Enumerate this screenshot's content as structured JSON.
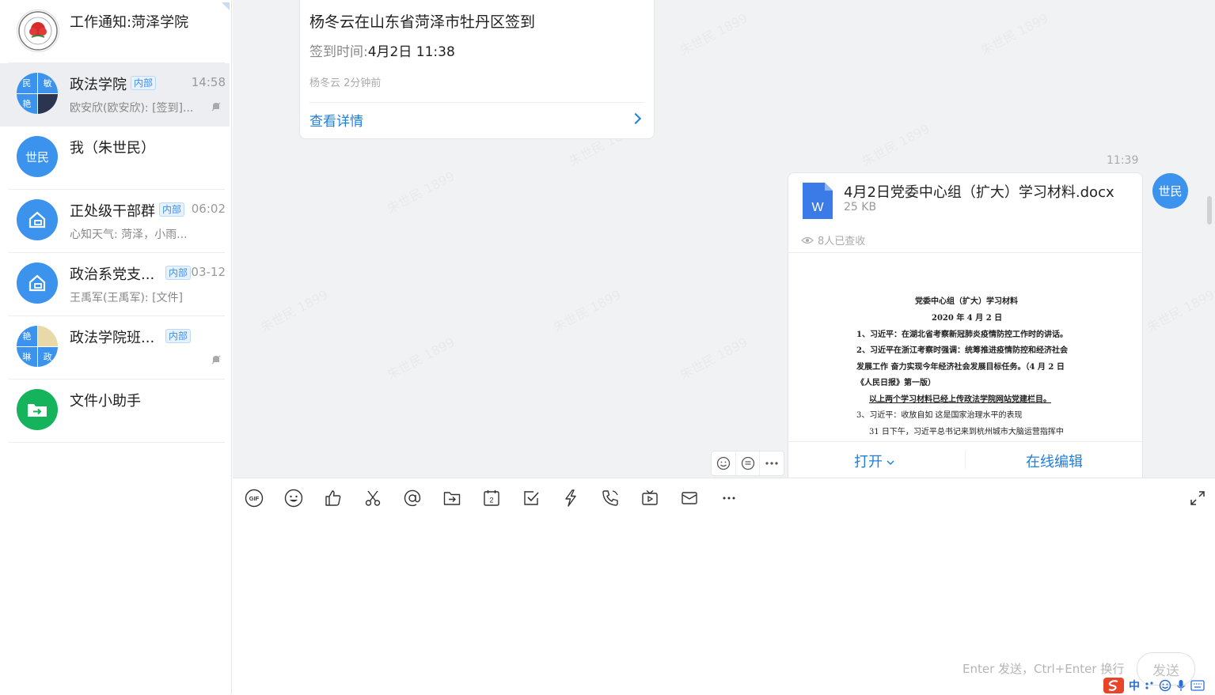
{
  "sidebar": {
    "items": [
      {
        "name": "工作通知:菏泽学院",
        "tag": "",
        "time": "",
        "preview": ""
      },
      {
        "name": "政法学院",
        "tag": "内部",
        "time": "14:58",
        "preview": "欧安欣(欧安欣): [签到]...",
        "avatar_chars": [
          "民",
          "敏",
          "艳",
          ""
        ]
      },
      {
        "name": "我（朱世民）",
        "tag": "",
        "time": "",
        "preview": "",
        "avatar_text": "世民"
      },
      {
        "name": "正处级干部群",
        "tag": "内部",
        "time": "06:02",
        "preview": "心知天气: 菏泽，小雨..."
      },
      {
        "name": "政治系党支...",
        "tag": "内部",
        "time": "03-12",
        "preview": "王禹军(王禹军): [文件]"
      },
      {
        "name": "政法学院班...",
        "tag": "内部",
        "time": "",
        "preview": "",
        "avatar_chars": [
          "艳",
          "",
          "琳",
          "政"
        ]
      },
      {
        "name": "文件小助手",
        "tag": "",
        "time": "",
        "preview": ""
      }
    ]
  },
  "chat": {
    "watermark_text": "朱世民 1899",
    "checkin_card": {
      "title": "杨冬云在山东省菏泽市牡丹区签到",
      "time_label": "签到时间:",
      "time_value": "4月2日 11:38",
      "meta": "杨冬云 2分钟前",
      "detail_link": "查看详情"
    },
    "timestamp": "11:39",
    "my_avatar": "世民",
    "file_card": {
      "filename": "4月2日党委中心组（扩大）学习材料.docx",
      "size": "25 KB",
      "seen": "8人已查收",
      "icon_letter": "W",
      "open_label": "打开",
      "edit_label": "在线编辑",
      "preview_lines": [
        "党委中心组（扩大）学习材料",
        "2020 年 4 月 2 日",
        "1、习近平：在湖北省考察新冠肺炎疫情防控工作时的讲话。",
        "2、习近平在浙江考察时强调：统筹推进疫情防控和经济社会",
        "发展工作  奋力实现今年经济社会发展目标任务。（4 月 2 日",
        "《人民日报》第一版）",
        "以上两个学习材料已经上传政法学院网站党建栏目。",
        "3、习近平：收放自如  这是国家治理水平的表现",
        "31 日下午，习近平总书记来到杭州城市大脑运营指挥中"
      ]
    }
  },
  "toolbar": {
    "tools": [
      "gif-icon",
      "emoji-icon",
      "thumbs-up-icon",
      "scissors-icon",
      "at-icon",
      "folder-icon",
      "calendar-icon",
      "checkbox-icon",
      "lightning-icon",
      "phone-icon",
      "live-icon",
      "mail-icon",
      "more-icon"
    ],
    "calendar_num": "2",
    "gif_label": "GIF"
  },
  "input": {
    "hint": "Enter 发送，Ctrl+Enter 换行",
    "send_label": "发送"
  },
  "ime": {
    "label": "中"
  },
  "colors": {
    "accent": "#1e7fdc",
    "avatar_blue": "#3b93ee",
    "green": "#14b35c"
  }
}
